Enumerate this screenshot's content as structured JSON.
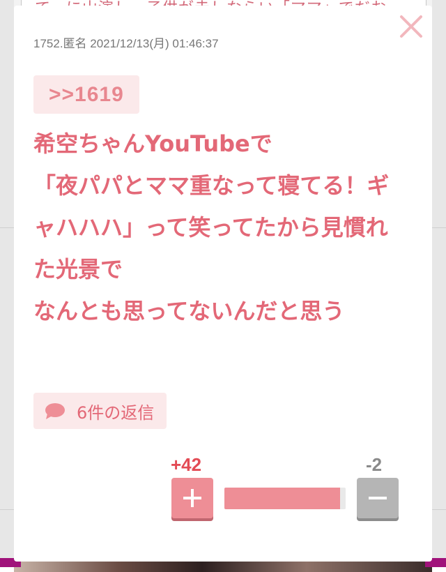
{
  "background": {
    "peek_text": "て、に山演し　子供が赤しならい「ママ」でだお"
  },
  "post": {
    "meta": "1752.匿名 2021/12/13(月) 01:46:37",
    "anchor": ">>1619",
    "body": "希空ちゃんYouTubeで\n「夜パパとママ重なって寝てる！ギャハハハ」って笑ってたから見慣れた光景で\nなんとも思ってないんだと思う",
    "replies_label": "6件の返信"
  },
  "votes": {
    "plus_label": "+42",
    "minus_label": "-2",
    "plus_ratio": 0.955
  },
  "colors": {
    "accent": "#e36877",
    "accent_light": "#fbe9ea",
    "plus_button": "#ee8e96",
    "minus_button": "#b5b5b5",
    "close_icon": "#f2b7bd"
  }
}
